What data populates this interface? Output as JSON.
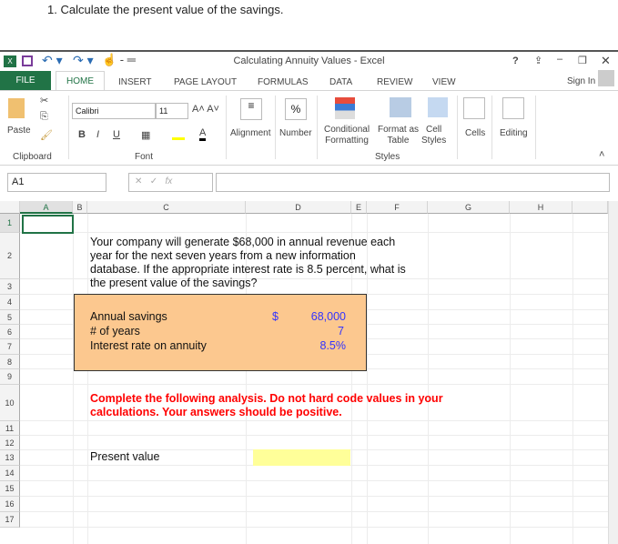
{
  "question": "1. Calculate the present value of the savings.",
  "window": {
    "title": "Calculating Annuity Values - Excel",
    "help": "?",
    "sign_in": "Sign In"
  },
  "tabs": [
    "FILE",
    "HOME",
    "INSERT",
    "PAGE LAYOUT",
    "FORMULAS",
    "DATA",
    "REVIEW",
    "VIEW"
  ],
  "ribbon": {
    "paste": "Paste",
    "clipboard": "Clipboard",
    "font_name": "Calibri",
    "font_size": "11",
    "bold": "B",
    "italic": "I",
    "underline": "U",
    "font_color": "A",
    "font_group": "Font",
    "alignment": "Alignment",
    "number": "Number",
    "percent": "%",
    "conditional1": "Conditional",
    "conditional2": "Formatting",
    "format_as1": "Format as",
    "format_as2": "Table",
    "cell_styles1": "Cell",
    "cell_styles2": "Styles",
    "styles_group": "Styles",
    "cells": "Cells",
    "editing": "Editing"
  },
  "formula_bar": {
    "name_box": "A1",
    "fx": "fx",
    "value": ""
  },
  "columns": [
    "A",
    "B",
    "C",
    "D",
    "E",
    "F",
    "G",
    "H"
  ],
  "rows": [
    "1",
    "2",
    "3",
    "4",
    "5",
    "6",
    "7",
    "8",
    "9",
    "10",
    "11",
    "12",
    "13",
    "14",
    "15",
    "16",
    "17"
  ],
  "sheet": {
    "intro": "Your company will generate $68,000 in annual revenue each year for the next seven years from a new information database. If the appropriate interest rate is 8.5 percent, what is the present value of the savings?",
    "inputs": [
      {
        "label": "Annual savings",
        "currency": "$",
        "value": "68,000"
      },
      {
        "label": "# of years",
        "value": "7"
      },
      {
        "label": "Interest rate on annuity",
        "value": "8.5%"
      }
    ],
    "instruction": "Complete the following analysis. Do not hard code values in your calculations. Your answers should be positive.",
    "pv_label": "Present value",
    "pv_value": ""
  },
  "colors": {
    "file_tab": "#217346",
    "input_box": "#fcc88f",
    "answer_cell": "#ffff99",
    "instruction": "#ff0000",
    "input_value": "#3333ff"
  }
}
